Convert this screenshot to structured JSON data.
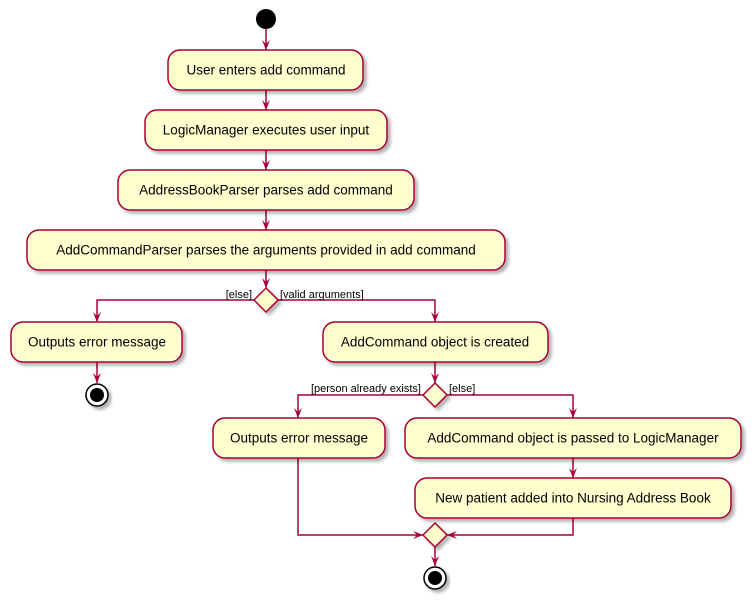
{
  "colors": {
    "fill": "#FEFECE",
    "stroke": "#A80036"
  },
  "activities": {
    "a1": "User enters add command",
    "a2": "LogicManager executes user input",
    "a3": "AddressBookParser parses add command",
    "a4": "AddCommandParser parses the arguments provided in add command",
    "a5": "Outputs error message",
    "a6": "AddCommand object is created",
    "a7": "Outputs error message",
    "a8": "AddCommand object is passed to LogicManager",
    "a9": "New patient added into Nursing Address Book"
  },
  "guards": {
    "g1_left": "[else]",
    "g1_right": "[valid arguments]",
    "g2_left": "[person already exists]",
    "g2_right": "[else]"
  }
}
